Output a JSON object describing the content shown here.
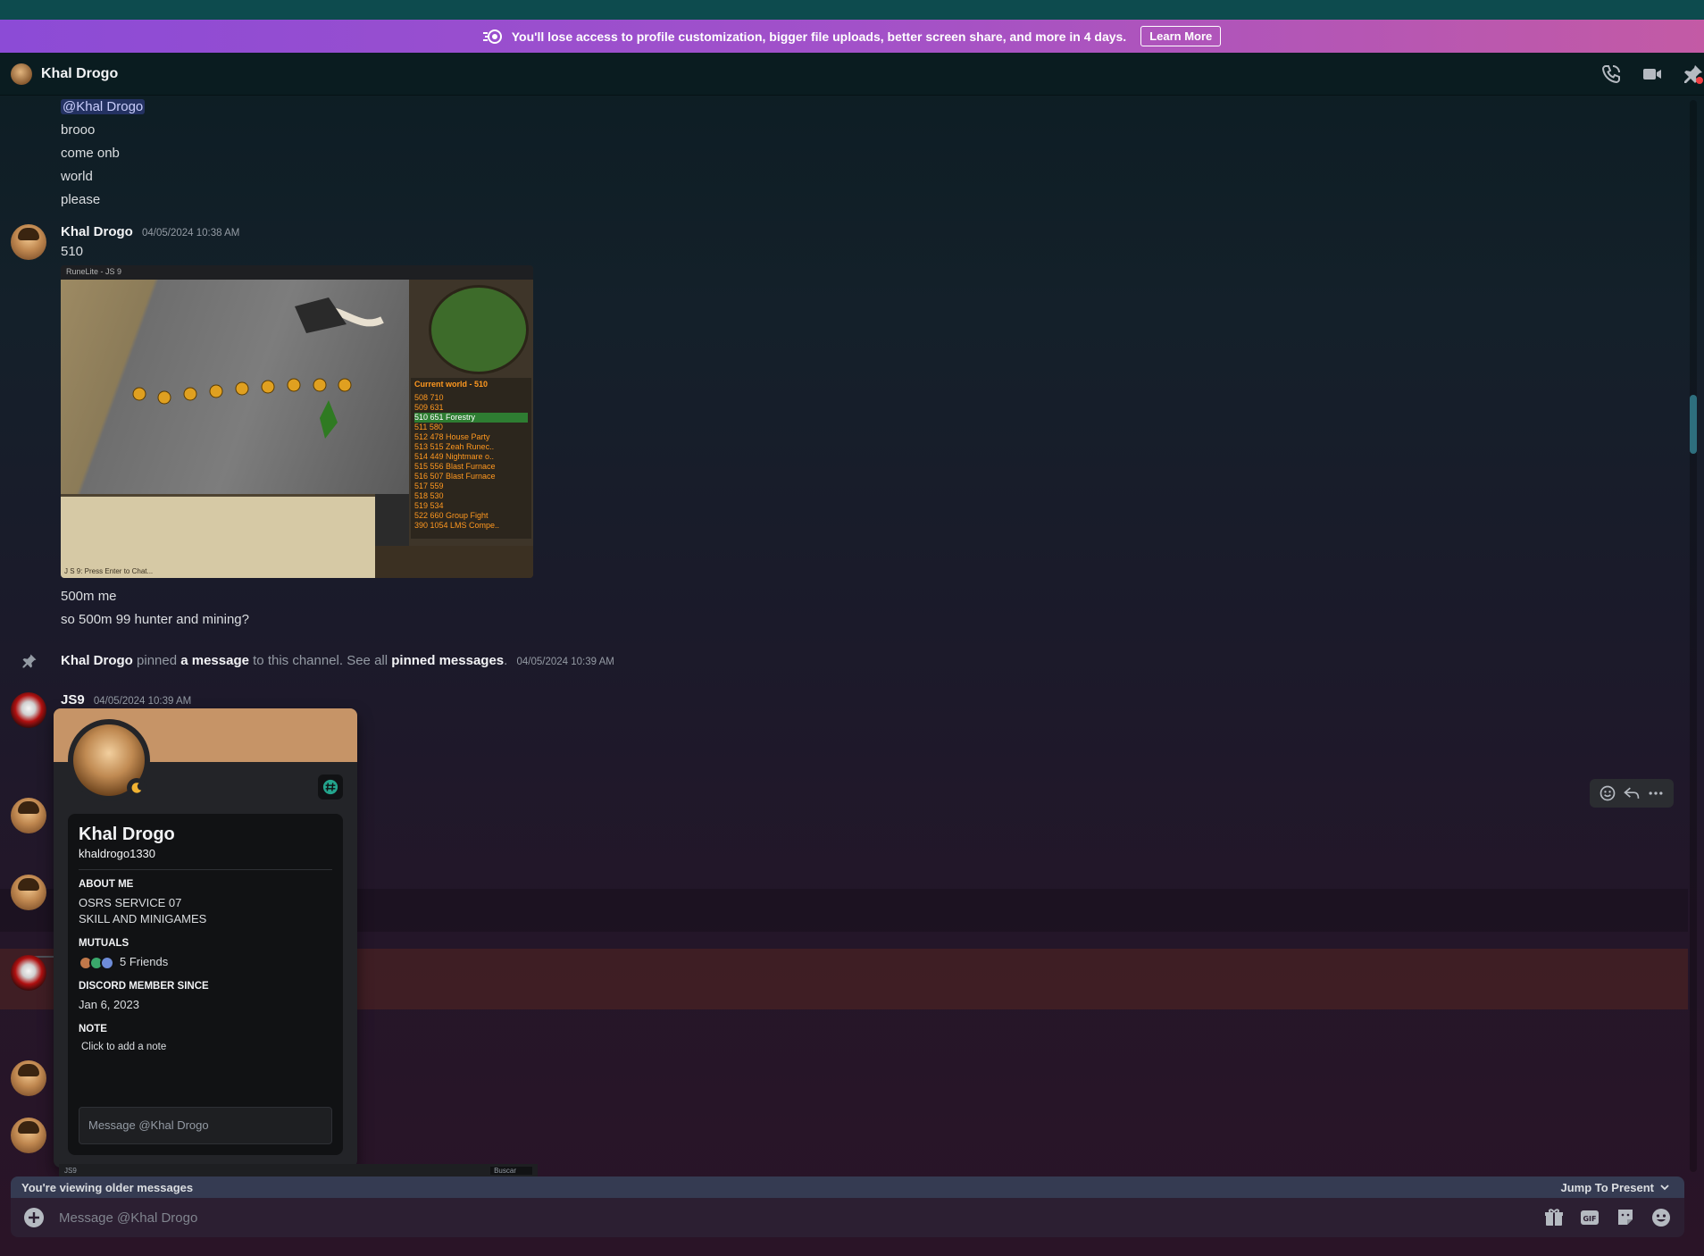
{
  "banner": {
    "text": "You'll lose access to profile customization, bigger file uploads, better screen share, and more in 4 days.",
    "button": "Learn More"
  },
  "header": {
    "name": "Khal Drogo"
  },
  "messages": {
    "m1_mention": "@Khal Drogo",
    "m1_lines": [
      "brooo",
      "come onb",
      "world",
      "please"
    ],
    "m2_author": "Khal Drogo",
    "m2_time": "04/05/2024 10:38 AM",
    "m2_text": "510",
    "m2_after": [
      "500m me",
      "so 500m 99 hunter and mining?"
    ],
    "pin_author": "Khal Drogo",
    "pin_pinned": "pinned",
    "pin_link1": "a message",
    "pin_mid": "to this channel. See all",
    "pin_link2": "pinned messages",
    "pin_dot": ".",
    "pin_time": "04/05/2024 10:39 AM",
    "m3_author": "JS9",
    "m3_time": "04/05/2024 10:39 AM"
  },
  "game": {
    "title": "RuneLite - JS 9",
    "worldlist_header": "Current world - 510",
    "worlds": [
      "508 710",
      "509 631",
      "510 651 Forestry",
      "511 580",
      "512 478 House Party",
      "513 515 Zeah Runec..",
      "514 449 Nightmare o..",
      "515 556 Blast Furnace",
      "516 507 Blast Furnace",
      "517 559",
      "518 530",
      "519 534",
      "522 660 Group Fight",
      "390 1054 LMS Compe.."
    ],
    "chat_prompt": "J S 9: Press Enter to Chat..."
  },
  "profile": {
    "name": "Khal Drogo",
    "username": "khaldrogo1330",
    "about_label": "About Me",
    "about_lines": [
      "OSRS SERVICE 07",
      "SKILL AND MINIGAMES"
    ],
    "mutuals_label": "Mutuals",
    "mutuals_text": "5 Friends",
    "member_label": "Discord Member Since",
    "member_date": "Jan 6, 2023",
    "note_label": "Note",
    "note_text": "Click to add a note",
    "message_placeholder": "Message @Khal Drogo"
  },
  "mini_strip": {
    "label": "JS9",
    "search": "Buscar"
  },
  "older_bar": {
    "text": "You're viewing older messages",
    "jump": "Jump To Present"
  },
  "composer": {
    "placeholder": "Message @Khal Drogo"
  },
  "colors": {
    "banner_start": "#8c4bd6",
    "banner_end": "#c35aa5",
    "profile_banner": "#c69467",
    "reply_highlight": "#3a2524"
  },
  "icons": [
    "nitro-icon",
    "phone-icon",
    "video-icon",
    "pin-icon",
    "plus-icon",
    "gift-icon",
    "gif-icon",
    "sticker-icon",
    "emoji-icon",
    "reaction-icon",
    "reply-icon",
    "more-icon",
    "moon-icon",
    "hash-badge-icon",
    "chevron-down-icon"
  ]
}
